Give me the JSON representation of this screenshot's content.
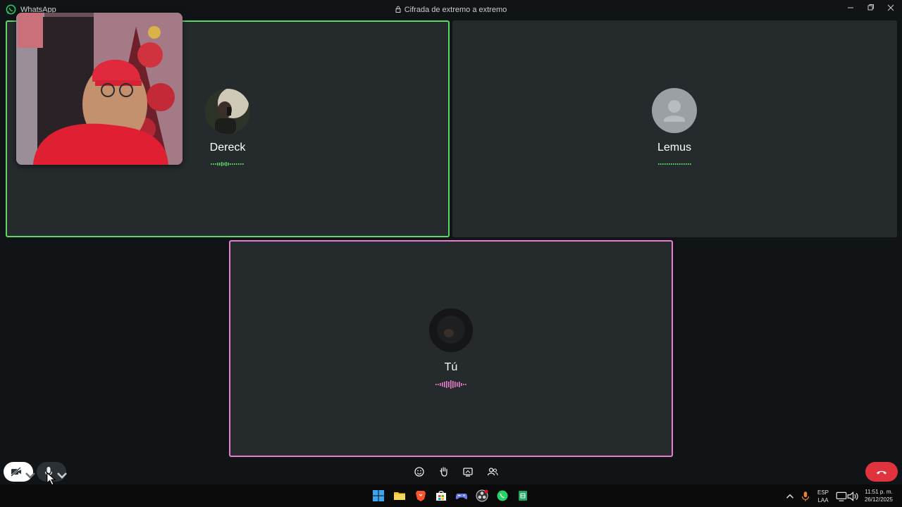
{
  "window": {
    "app_name": "WhatsApp",
    "encryption_label": "Cifrada de extremo a extremo",
    "icons": [
      "whatsapp-icon",
      "lock-icon",
      "minimize-icon",
      "maximize-icon",
      "close-icon"
    ]
  },
  "participants": [
    {
      "name": "Dereck",
      "speaking": true,
      "border_color": "#5cd868",
      "level_color": "#5cd868"
    },
    {
      "name": "Lemus",
      "speaking": false,
      "level_color": "#5cd868"
    },
    {
      "name": "Tú",
      "speaking": true,
      "border_color": "#e87ccf",
      "level_color": "#e87ccf"
    }
  ],
  "controls": {
    "left": [
      "camera-off-icon",
      "chevron-down-icon",
      "microphone-icon",
      "chevron-down-icon"
    ],
    "center": [
      "emoji-icon",
      "raise-hand-icon",
      "screen-share-icon",
      "participants-icon"
    ],
    "end_call": "end-call-icon",
    "end_call_color": "#e0333d"
  },
  "taskbar": {
    "apps": [
      "windows-start-icon",
      "file-explorer-icon",
      "brave-browser-icon",
      "store-icon",
      "game-controller-icon",
      "obs-icon",
      "whatsapp-icon",
      "sheets-icon"
    ],
    "language_line1": "ESP",
    "language_line2": "LAA",
    "time": "11:51 p. m.",
    "date": "26/12/2025"
  }
}
